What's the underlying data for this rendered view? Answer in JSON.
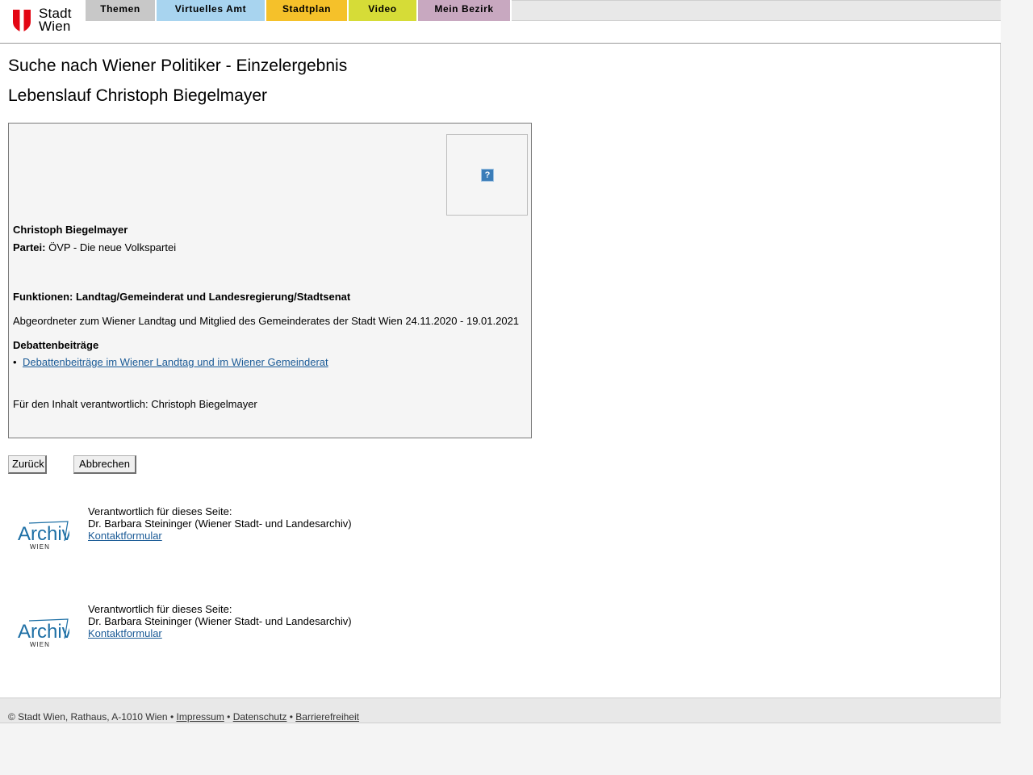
{
  "header": {
    "logo_text_line1": "Stadt",
    "logo_text_line2": "Wien",
    "tabs": [
      {
        "label": "Themen",
        "color": "#c8c8c8"
      },
      {
        "label": "Virtuelles Amt",
        "color": "#a8d4ef"
      },
      {
        "label": "Stadtplan",
        "color": "#f5c12a"
      },
      {
        "label": "Video",
        "color": "#d6dc37"
      },
      {
        "label": "Mein Bezirk",
        "color": "#c8a8c0"
      }
    ]
  },
  "main": {
    "title": "Suche nach Wiener Politiker - Einzelergebnis",
    "subtitle": "Lebenslauf Christoph Biegelmayer",
    "card": {
      "photo_placeholder": "?",
      "name": "Christoph Biegelmayer",
      "party_label": "Partei:",
      "party_value": " ÖVP - Die neue Volkspartei",
      "functions_title": "Funktionen: Landtag/Gemeinderat und Landesregierung/Stadtsenat",
      "function_text": "Abgeordneter zum Wiener Landtag und Mitglied des Gemeinderates der Stadt Wien 24.11.2020 - 19.01.2021",
      "debates_title": "Debattenbeiträge",
      "debates_link": "Debattenbeiträge im Wiener Landtag und im Wiener Gemeinderat",
      "responsible": "Für den Inhalt verantwortlich: Christoph Biegelmayer"
    },
    "buttons": {
      "back": "Zurück",
      "cancel": "Abbrechen"
    }
  },
  "contacts": [
    {
      "logo_text": "Archiv",
      "logo_sub": "WIEN",
      "line1": "Verantwortlich für dieses Seite:",
      "line2": "Dr. Barbara Steininger (Wiener Stadt- und Landesarchiv)",
      "link": "Kontaktformular"
    },
    {
      "logo_text": "Archiv",
      "logo_sub": "WIEN",
      "line1": "Verantwortlich für dieses Seite:",
      "line2": "Dr. Barbara Steininger (Wiener Stadt- und Landesarchiv)",
      "link": "Kontaktformular"
    }
  ],
  "footer": {
    "copyright": "© Stadt Wien, Rathaus, A-1010 Wien",
    "separator": " • ",
    "impressum": "Impressum",
    "datenschutz": "Datenschutz",
    "barrierefreiheit": "Barrierefreiheit"
  },
  "colors": {
    "link": "#1a5a96",
    "logo_red": "#e30613",
    "archiv_blue": "#1d6fa5"
  }
}
